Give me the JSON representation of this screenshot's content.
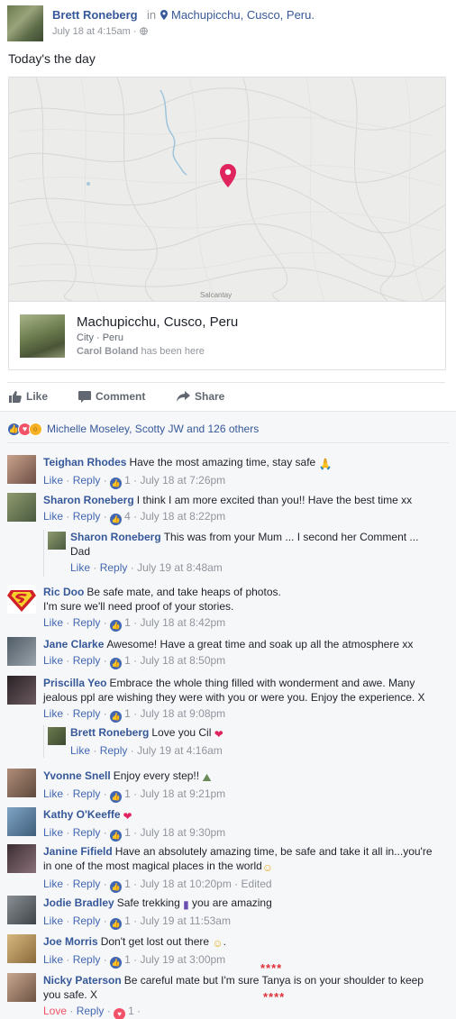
{
  "post": {
    "author": "Brett Roneberg",
    "in_word": "in",
    "location": "Machupicchu, Cusco, Peru.",
    "time": "July 18 at 4:15am ·",
    "text": "Today's the day"
  },
  "map": {
    "label": "Salcantay",
    "place_name": "Machupicchu, Cusco, Peru",
    "place_type": "City · Peru",
    "visitor_name": "Carol Boland",
    "visitor_suffix": "has been here"
  },
  "actions": {
    "like": "Like",
    "comment": "Comment",
    "share": "Share"
  },
  "reactions": {
    "text": "Michelle Moseley, Scotty JW and 126 others"
  },
  "colors": {
    "link": "#365899",
    "like_blue": "#4267b2",
    "love_red": "#f25268",
    "pin": "#e0245e"
  },
  "comments": [
    {
      "name": "Teighan Rhodes",
      "text": "Have the most amazing time, stay safe",
      "meta_count": "1",
      "time": "July 18 at 7:26pm"
    },
    {
      "name": "Sharon Roneberg",
      "text": "I think I am more excited than you!! Have the best time xx",
      "meta_count": "4",
      "time": "July 18 at 8:22pm"
    },
    {
      "name": "Sharon Roneberg",
      "text": "This was from your Mum ... I second her Comment ...",
      "text2": "Dad",
      "time": "July 19 at 8:48am"
    },
    {
      "name": "Ric Doo",
      "text": "Be safe mate, and take heaps of photos.",
      "text2": "I'm sure we'll need proof of your stories.",
      "meta_count": "1",
      "time": "July 18 at 8:42pm"
    },
    {
      "name": "Jane Clarke",
      "text": "Awesome! Have a great time and soak up all the atmosphere xx",
      "meta_count": "1",
      "time": "July 18 at 8:50pm"
    },
    {
      "name": "Priscilla Yeo",
      "text": "Embrace the whole thing filled with wonderment and awe. Many",
      "text2": "jealous ppl are wishing they were with you or were you. Enjoy the experience. X",
      "meta_count": "1",
      "time": "July 18 at 9:08pm"
    },
    {
      "name": "Brett Roneberg",
      "text": "Love you Cil",
      "time": "July 19 at 4:16am"
    },
    {
      "name": "Yvonne Snell",
      "text": "Enjoy every step!!",
      "meta_count": "1",
      "time": "July 18 at 9:21pm"
    },
    {
      "name": "Kathy O'Keeffe",
      "text": "",
      "meta_count": "1",
      "time": "July 18 at 9:30pm"
    },
    {
      "name": "Janine Fifield",
      "text": "Have an absolutely amazing time, be safe and take it all in...you're",
      "text2": "in one of the most magical places in the world",
      "meta_count": "1",
      "time": "July 18 at 10:20pm · Edited"
    },
    {
      "name": "Jodie Bradley",
      "text": "Safe trekking",
      "text_after": "you are amazing",
      "meta_count": "1",
      "time": "July 19 at 11:53am"
    },
    {
      "name": "Joe Morris",
      "text": "Don't get lost out there",
      "meta_count": "1",
      "time": "July 19 at 3:00pm"
    },
    {
      "name": "Nicky Paterson",
      "text": "Be careful mate but I'm sure Tanya is on your shoulder to keep",
      "text2": "you safe. X",
      "meta_count": "1",
      "love_label": "Love"
    }
  ],
  "meta": {
    "like": "Like",
    "reply": "Reply",
    "sep": "·"
  },
  "annotation": {
    "stars": "****"
  }
}
